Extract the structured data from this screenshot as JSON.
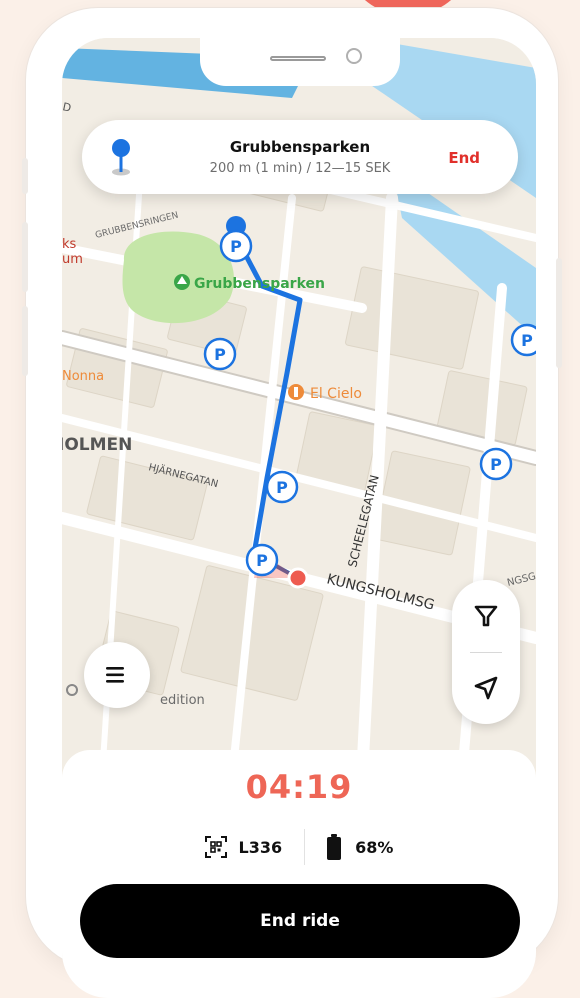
{
  "navigation": {
    "destination": "Grubbensparken",
    "route_info": "200 m (1 min) / 12—15 SEK",
    "end_label": "End"
  },
  "map": {
    "labels": {
      "park": "Grubbensparken",
      "restaurant": "El Cielo",
      "nonna": "Nonna",
      "district": "IOLMEN",
      "street_grubbensringen": "GRUBBENSRINGEN",
      "street_harnegatan": "HJÄRNEGATAN",
      "street_scheelegatan": "SCHEELEGATAN",
      "street_kungsholmsgatan": "KUNGSHOLMSG",
      "street_right": "NGSG",
      "top_left": "D",
      "left_cut_1": "ks",
      "left_cut_2": "um",
      "edition": "edition",
      "parking_symbol": "P"
    },
    "colors": {
      "route": "#1c73e0",
      "parking": "#1c73e0",
      "water": "#a9d8f2",
      "park": "#c5e6a8",
      "user_marker": "#ee5b50"
    }
  },
  "ride": {
    "timer": "04:19",
    "vehicle_id": "L336",
    "battery": "68%",
    "end_ride_label": "End ride"
  },
  "icons": {
    "destination": "pin-icon",
    "menu": "hamburger-menu-icon",
    "filter": "filter-icon",
    "locate": "navigation-arrow-icon",
    "qr": "qr-code-icon",
    "battery": "battery-icon"
  }
}
